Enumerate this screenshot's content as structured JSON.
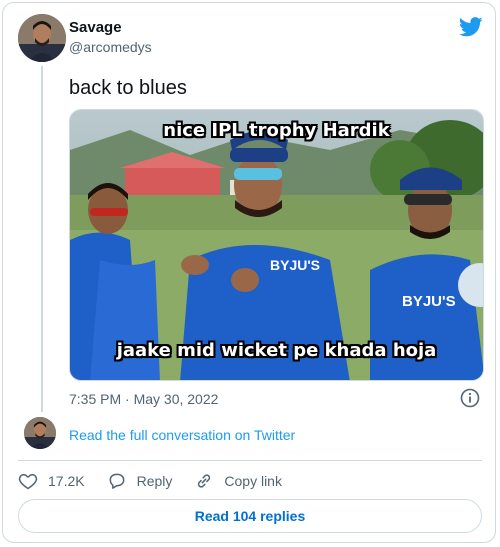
{
  "colors": {
    "twitter_blue": "#1d9bf0",
    "text_primary": "#0f1419",
    "text_secondary": "#536471",
    "border": "#cfd9de",
    "jersey_blue": "#1f5fc8"
  },
  "tweet": {
    "author_name": "Savage",
    "author_handle": "@arcomedys",
    "text": "back to blues",
    "timestamp": "7:35 PM · May 30, 2022",
    "logo_icon": "twitter-bird-icon"
  },
  "media": {
    "top_caption": "nice IPL trophy Hardik",
    "bottom_caption": "jaake mid wicket pe khada hoja",
    "jersey_text_center": "BYJU'S",
    "jersey_text_right": "BYJU'S"
  },
  "footer": {
    "read_conversation": "Read the full conversation on Twitter",
    "likes_count": "17.2K",
    "reply_label": "Reply",
    "copy_link_label": "Copy link",
    "read_replies": "Read 104 replies"
  }
}
